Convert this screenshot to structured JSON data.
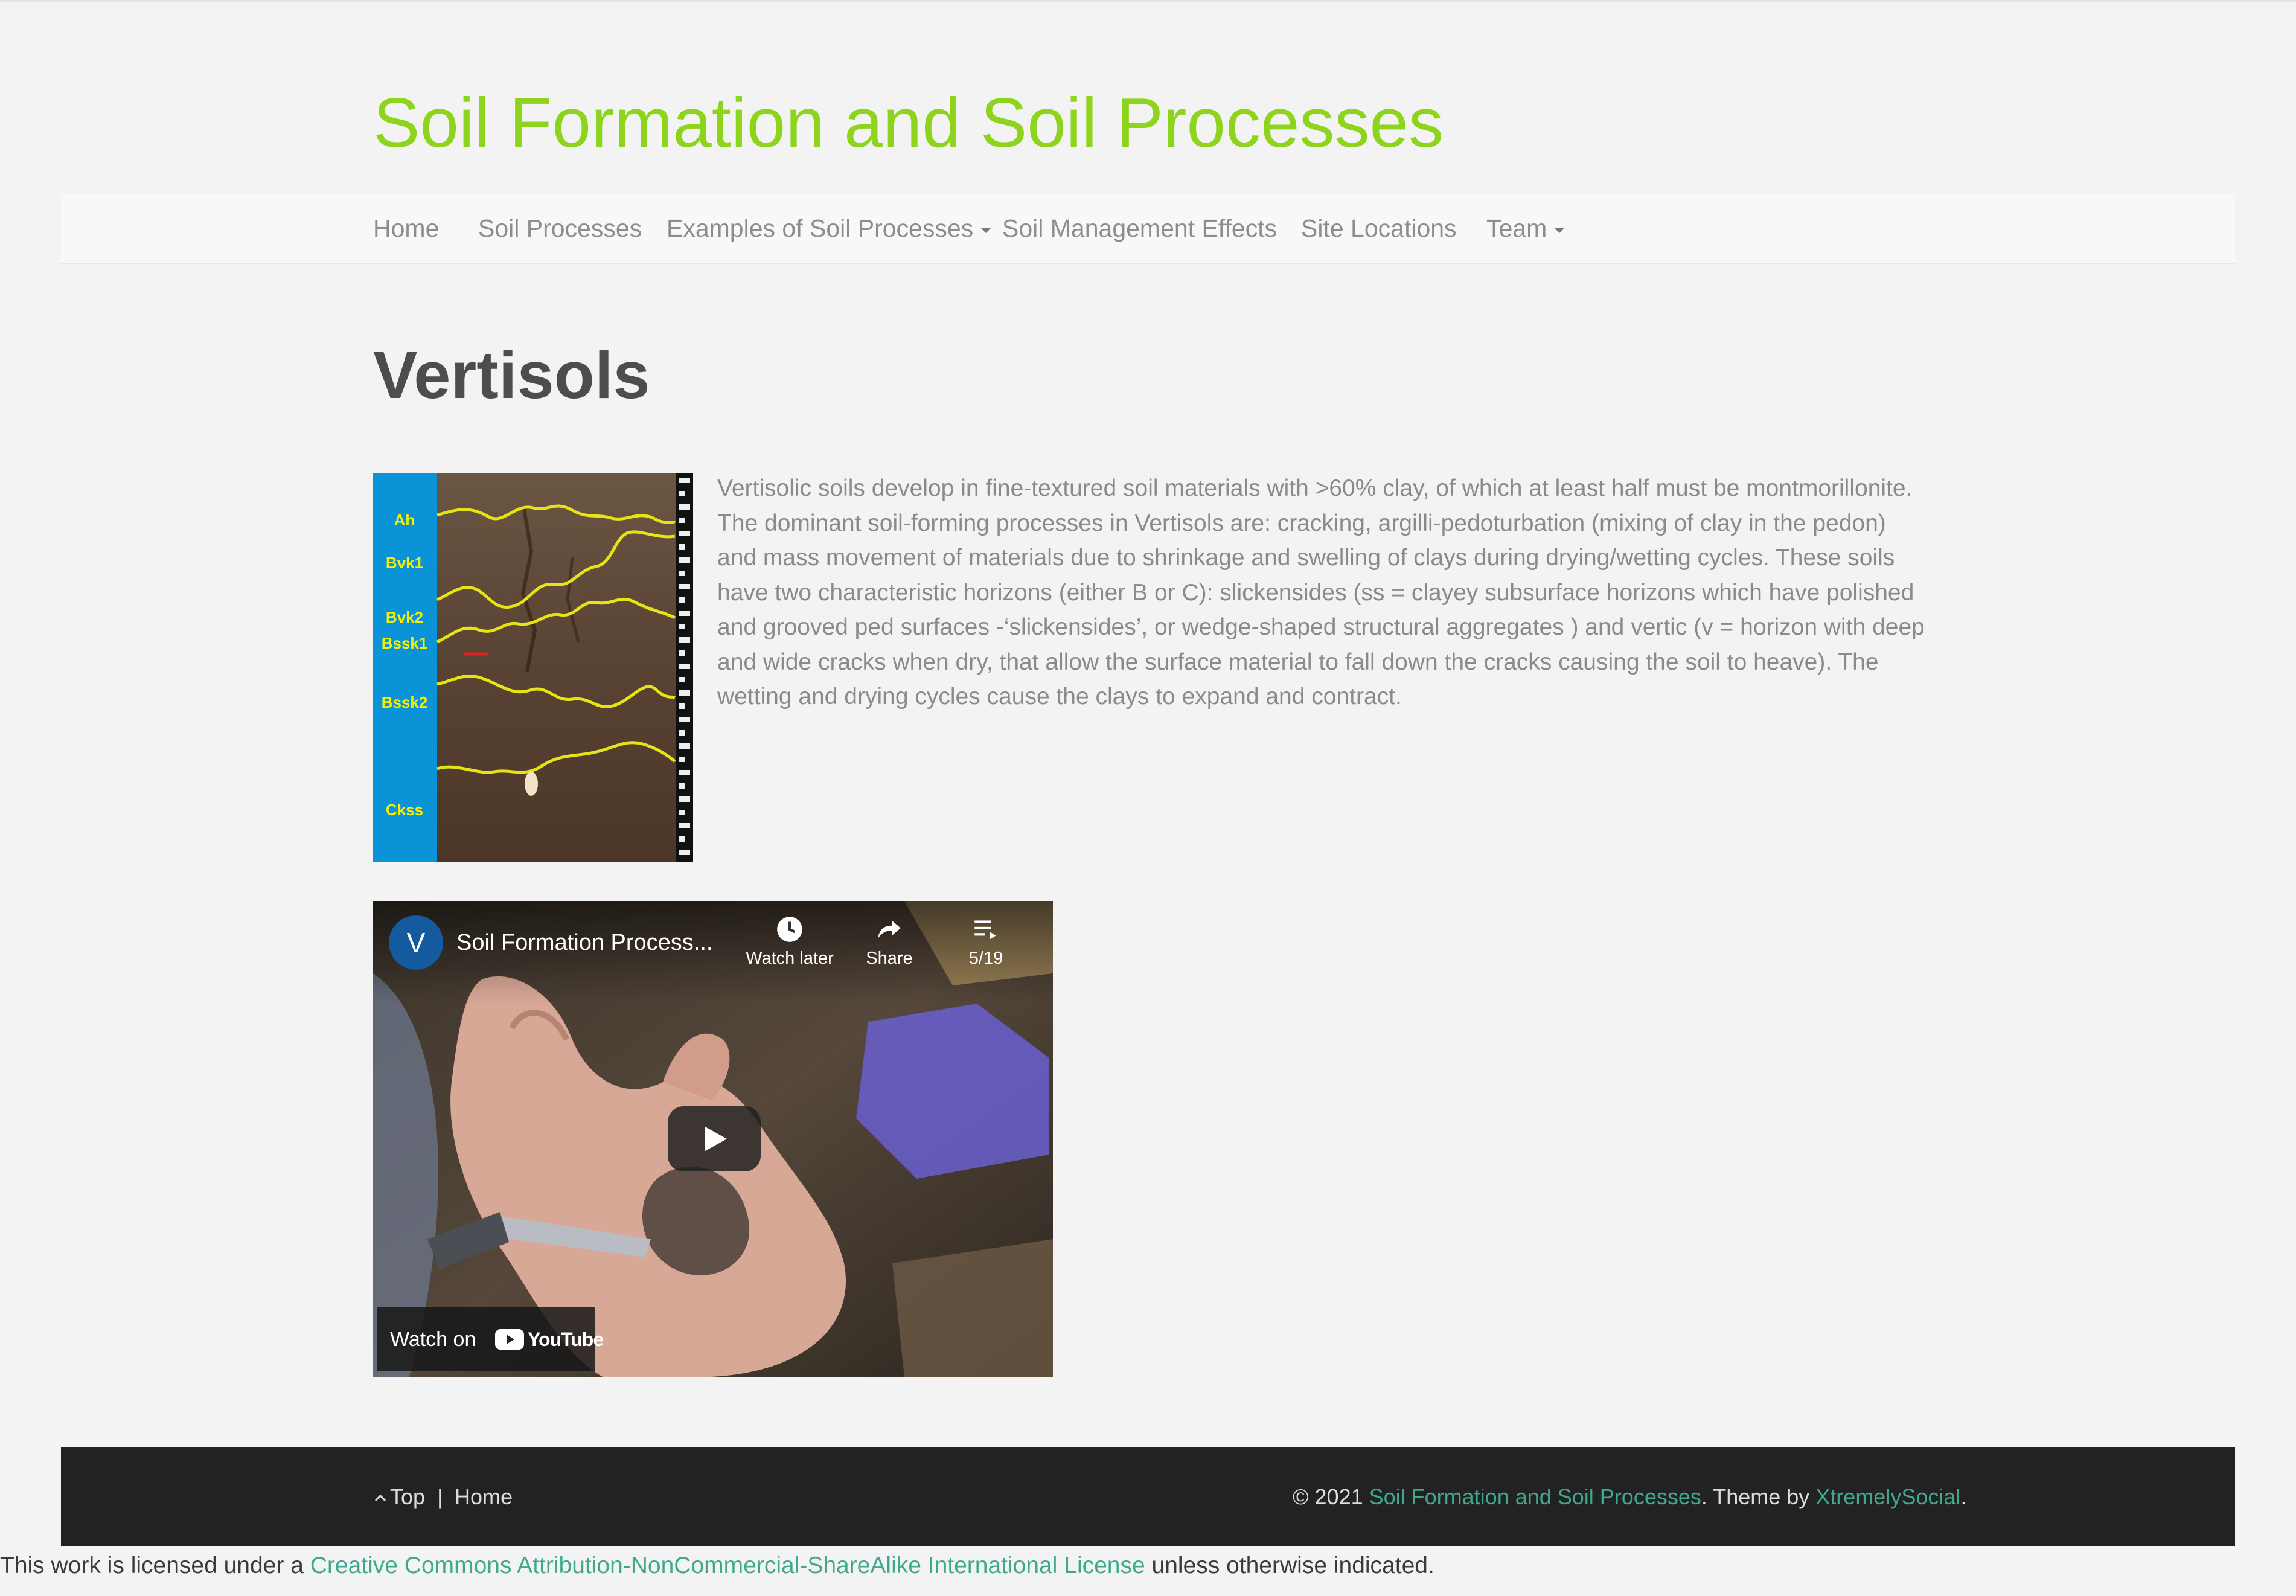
{
  "site": {
    "title": "Soil Formation and Soil Processes"
  },
  "nav": {
    "items": [
      {
        "label": "Home"
      },
      {
        "label": "Soil Processes"
      },
      {
        "label": "Examples of Soil Processes"
      },
      {
        "label": "Soil Management Effects"
      },
      {
        "label": "Site Locations"
      },
      {
        "label": "Team"
      }
    ]
  },
  "page": {
    "title": "Vertisols",
    "body": "Vertisolic soils develop in fine-textured soil materials with >60% clay, of which at least half must be montmorillonite. The dominant soil-forming processes in Vertisols are: cracking, argilli-pedoturbation (mixing of clay in the pedon) and mass movement of materials due to shrinkage and swelling of clays during drying/wetting cycles. These soils have two characteristic horizons (either B or C): slickensides (ss = clayey subsurface horizons which have polished and grooved ped surfaces -‘slickensides’, or wedge-shaped structural aggregates ) and vertic (v = horizon with deep and wide cracks when dry, that allow the surface material to fall down the cracks causing the soil to heave). The wetting and drying cycles cause the clays to expand and contract."
  },
  "figure": {
    "horizons": [
      "Ah",
      "Bvk1",
      "Bvk2",
      "Bssk1",
      "Bssk2",
      "Ckss"
    ],
    "colors": {
      "label_bg": "#0b93d8",
      "label_text": "#f3f000",
      "boundary": "#e6e414",
      "soil": "#5a4434"
    }
  },
  "video": {
    "channel_initial": "V",
    "title": "Soil Formation Process...",
    "watch_later": "Watch later",
    "share": "Share",
    "playlist_count": "5/19",
    "watch_on": "Watch on",
    "youtube": "YouTube"
  },
  "footer": {
    "top": "Top",
    "separator": "|",
    "home": "Home",
    "copyright_prefix": "© 2021 ",
    "site_link": "Soil Formation and Soil Processes",
    "theme_text": ". Theme by ",
    "theme_link": "XtremelySocial",
    "end": "."
  },
  "license": {
    "prefix": "This work is licensed under a ",
    "link": "Creative Commons Attribution-NonCommercial-ShareAlike International License",
    "suffix": " unless otherwise indicated."
  },
  "colors": {
    "accent": "#8ed41d",
    "link": "#3fa88f",
    "footer_bg": "#222222",
    "page_bg": "#f3f3f3"
  }
}
